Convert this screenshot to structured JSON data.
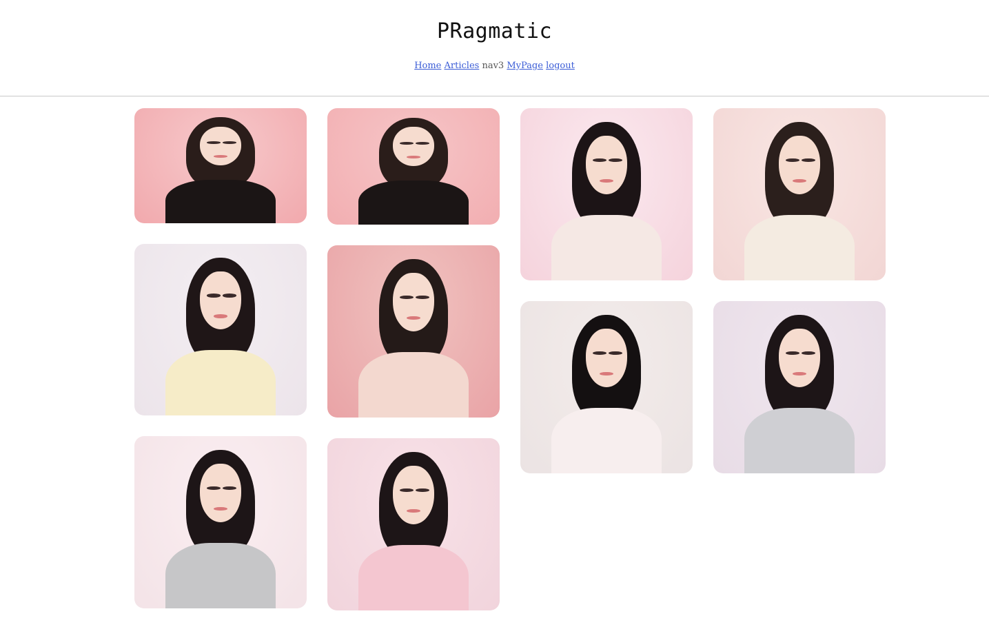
{
  "header": {
    "logo": "PRagmatic",
    "nav": {
      "home": "Home",
      "articles": "Articles",
      "nav3": "nav3",
      "mypage": "MyPage",
      "logout": "logout"
    }
  },
  "gallery": {
    "photos": [
      {
        "bg": "#f1a9ad",
        "outfit": "#1b1515",
        "hair": "#2a1d1a",
        "alt_bg": "#f7c9cb"
      },
      {
        "bg": "#f2aeb1",
        "outfit": "#1b1515",
        "hair": "#2a1d1a",
        "alt_bg": "#f6c5c7"
      },
      {
        "bg": "#f5d3dc",
        "outfit": "#f5e8e4",
        "hair": "#1c1416",
        "alt_bg": "#fbe9ef"
      },
      {
        "bg": "#f2d6d4",
        "outfit": "#f4ebe1",
        "hair": "#2b1f1c",
        "alt_bg": "#f9e6e3"
      },
      {
        "bg": "#ece4ea",
        "outfit": "#f6ecc8",
        "hair": "#1f1617",
        "alt_bg": "#f3eef2"
      },
      {
        "bg": "#e9a3a6",
        "outfit": "#f3d8cf",
        "hair": "#241a18",
        "alt_bg": "#f0c3c0"
      },
      {
        "bg": "#ebe3e3",
        "outfit": "#f7eeee",
        "hair": "#141011",
        "alt_bg": "#f3ecea"
      },
      {
        "bg": "#e8dce6",
        "outfit": "#cfcfd3",
        "hair": "#1d1517",
        "alt_bg": "#efe6ee"
      },
      {
        "bg": "#f3e3e7",
        "outfit": "#c6c6c8",
        "hair": "#1d1517",
        "alt_bg": "#fbeef1"
      },
      {
        "bg": "#f1d4dc",
        "outfit": "#f4c6d0",
        "hair": "#1d1517",
        "alt_bg": "#f8e2e8"
      }
    ]
  }
}
